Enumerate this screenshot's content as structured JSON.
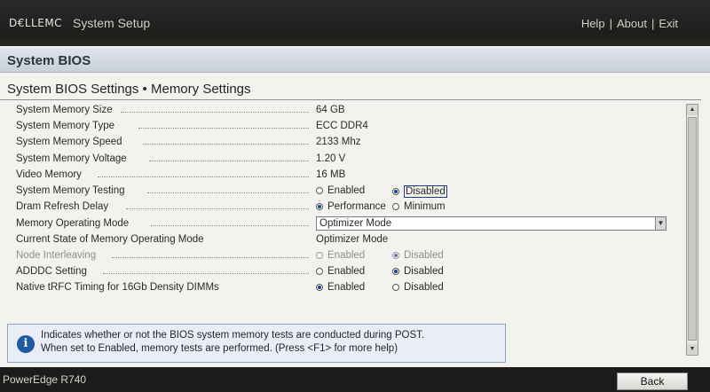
{
  "header": {
    "logo_text": "D€LLEMC",
    "app_title": "System Setup",
    "links": [
      "Help",
      "About",
      "Exit"
    ]
  },
  "section": {
    "title": "System BIOS",
    "page_title": "System BIOS Settings • Memory Settings"
  },
  "settings": [
    {
      "label": "System Memory Size",
      "type": "text",
      "value": "64 GB"
    },
    {
      "label": "System Memory Type",
      "type": "text",
      "value": "ECC DDR4"
    },
    {
      "label": "System Memory Speed",
      "type": "text",
      "value": "2133 Mhz"
    },
    {
      "label": "System Memory Voltage",
      "type": "text",
      "value": "1.20 V"
    },
    {
      "label": "Video Memory",
      "type": "text",
      "value": "16 MB"
    },
    {
      "label": "System Memory Testing",
      "type": "radio",
      "options": [
        "Enabled",
        "Disabled"
      ],
      "selected": "Disabled",
      "focused": "Disabled"
    },
    {
      "label": "Dram Refresh Delay",
      "type": "radio",
      "options": [
        "Performance",
        "Minimum"
      ],
      "selected": "Performance"
    },
    {
      "label": "Memory Operating Mode",
      "type": "dropdown",
      "value": "Optimizer Mode"
    },
    {
      "label": "Current State of Memory Operating Mode",
      "type": "text",
      "value": "Optimizer Mode"
    },
    {
      "label": "Node Interleaving",
      "type": "radio",
      "options": [
        "Enabled",
        "Disabled"
      ],
      "selected": "Disabled",
      "disabled": true
    },
    {
      "label": "ADDDC Setting",
      "type": "radio",
      "options": [
        "Enabled",
        "Disabled"
      ],
      "selected": "Disabled"
    },
    {
      "label": "Native tRFC Timing for 16Gb Density DIMMs",
      "type": "radio",
      "options": [
        "Enabled",
        "Disabled"
      ],
      "selected": "Enabled"
    }
  ],
  "help": {
    "line1": "Indicates whether or not the BIOS system memory tests are conducted during POST.",
    "line2": "When set to Enabled, memory tests are performed. (Press <F1> for more help)"
  },
  "footer": {
    "model": "PowerEdge R740",
    "back_label": "Back"
  },
  "colors": {
    "accent": "#1a3d8f",
    "header_bg": "#c9d0d8",
    "page_bg": "#f2f2ee"
  }
}
